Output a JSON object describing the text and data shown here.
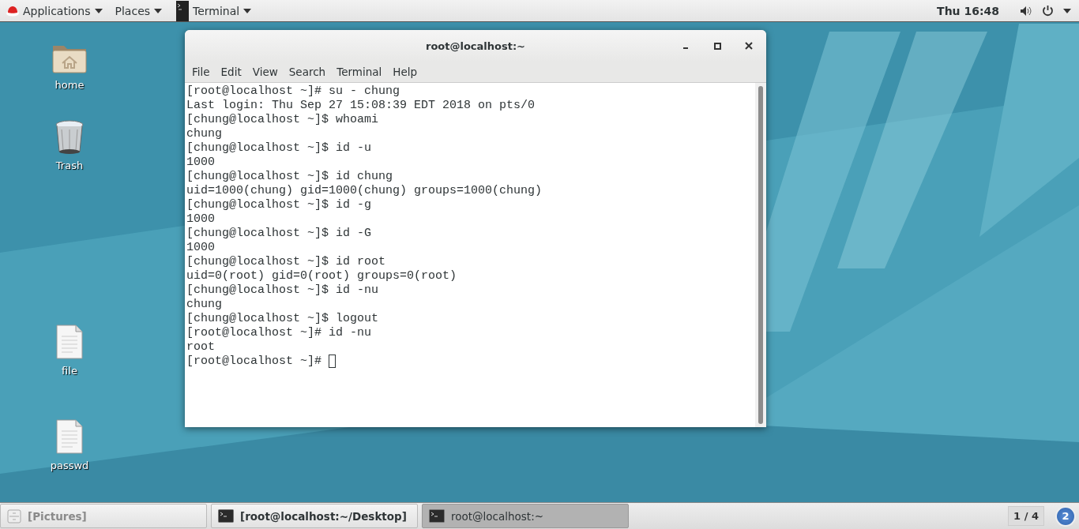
{
  "top_bar": {
    "menus": [
      {
        "label": "Applications",
        "kind": "logo"
      },
      {
        "label": "Places",
        "kind": "plain"
      },
      {
        "label": "Terminal",
        "kind": "app"
      }
    ],
    "clock": "Thu 16:48"
  },
  "desktop_icons": [
    {
      "label": "home",
      "kind": "folder"
    },
    {
      "label": "Trash",
      "kind": "trash"
    },
    {
      "label": "file",
      "kind": "document"
    },
    {
      "label": "passwd",
      "kind": "document"
    }
  ],
  "window": {
    "title": "root@localhost:~",
    "menu": [
      "File",
      "Edit",
      "View",
      "Search",
      "Terminal",
      "Help"
    ],
    "lines": [
      "[root@localhost ~]# su - chung",
      "Last login: Thu Sep 27 15:08:39 EDT 2018 on pts/0",
      "[chung@localhost ~]$ whoami",
      "chung",
      "[chung@localhost ~]$ id -u",
      "1000",
      "[chung@localhost ~]$ id chung",
      "uid=1000(chung) gid=1000(chung) groups=1000(chung)",
      "[chung@localhost ~]$ id -g",
      "1000",
      "[chung@localhost ~]$ id -G",
      "1000",
      "[chung@localhost ~]$ id root",
      "uid=0(root) gid=0(root) groups=0(root)",
      "[chung@localhost ~]$ id -nu",
      "chung",
      "[chung@localhost ~]$ logout",
      "[root@localhost ~]# id -nu",
      "root",
      "[root@localhost ~]# "
    ]
  },
  "taskbar": {
    "items": [
      {
        "label": "[Pictures]",
        "kind": "files",
        "selected": false
      },
      {
        "label": "[root@localhost:~/Desktop]",
        "kind": "terminal",
        "selected": false
      },
      {
        "label": "root@localhost:~",
        "kind": "terminal",
        "selected": true
      }
    ],
    "workspace": "1 / 4",
    "notifications": "2"
  }
}
